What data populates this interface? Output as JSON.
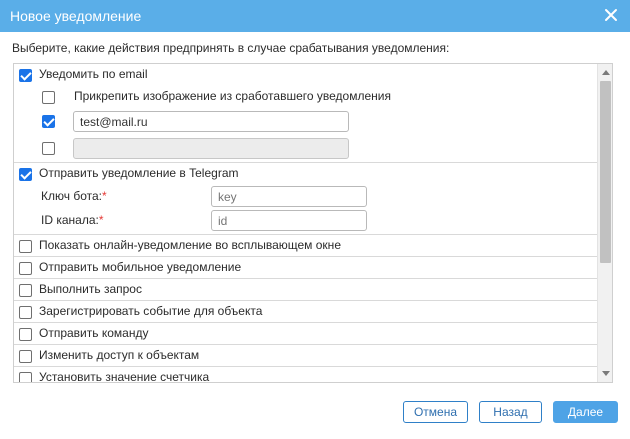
{
  "dialog": {
    "title": "Новое уведомление"
  },
  "prompt": "Выберите, какие действия предпринять в случае срабатывания уведомления:",
  "email": {
    "label": "Уведомить по email",
    "checked": true,
    "attach_label": "Прикрепить изображение из сработавшего уведомления",
    "attach_checked": false,
    "address_checked": true,
    "address_value": "test@mail.ru",
    "extra_checked": false,
    "extra_value": ""
  },
  "telegram": {
    "label": "Отправить уведомление в Telegram",
    "checked": true,
    "bot_key_label": "Ключ бота:",
    "bot_key_placeholder": "key",
    "channel_id_label": "ID канала:",
    "channel_id_placeholder": "id",
    "required_mark": "*"
  },
  "actions": [
    {
      "label": "Показать онлайн-уведомление во всплывающем окне",
      "checked": false
    },
    {
      "label": "Отправить мобильное уведомление",
      "checked": false
    },
    {
      "label": "Выполнить запрос",
      "checked": false
    },
    {
      "label": "Зарегистрировать событие для объекта",
      "checked": false
    },
    {
      "label": "Отправить команду",
      "checked": false
    },
    {
      "label": "Изменить доступ к объектам",
      "checked": false
    },
    {
      "label": "Установить значение счетчика",
      "checked": false
    }
  ],
  "buttons": {
    "cancel": "Отмена",
    "back": "Назад",
    "next": "Далее"
  },
  "colors": {
    "titlebar": "#5aaee8",
    "checkbox_checked": "#1a73e8",
    "primary_button": "#4ea3e6",
    "required": "#e53935"
  },
  "icons": {
    "close": "close-icon",
    "scroll_up": "chevron-up-icon",
    "scroll_down": "chevron-down-icon"
  }
}
